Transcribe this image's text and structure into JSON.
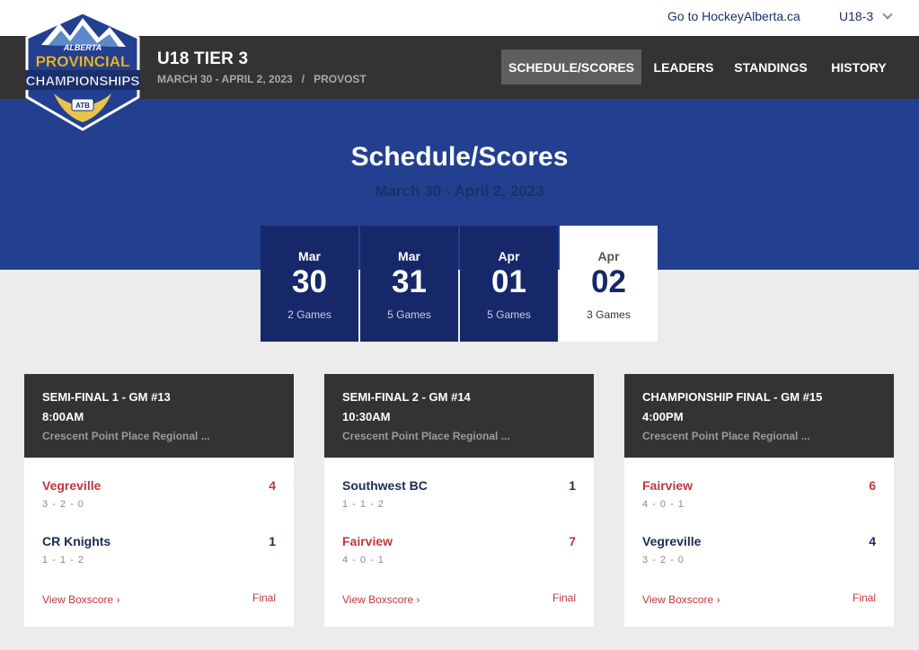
{
  "utility": {
    "link": "Go to HockeyAlberta.ca",
    "division": "U18-3"
  },
  "logo": {
    "line1": "ALBERTA",
    "line2": "PROVINCIAL",
    "line3": "CHAMPIONSHIPS",
    "sponsor": "ATB"
  },
  "event": {
    "title": "U18 TIER 3",
    "dates": "MARCH 30 - APRIL 2, 2023",
    "separator": "/",
    "location": "PROVOST"
  },
  "nav": [
    "SCHEDULE/SCORES",
    "LEADERS",
    "STANDINGS",
    "HISTORY"
  ],
  "page": {
    "title": "Schedule/Scores",
    "dates": "March 30 - April 2, 2023"
  },
  "days": [
    {
      "month": "Mar",
      "day": "30",
      "games": "2 Games"
    },
    {
      "month": "Mar",
      "day": "31",
      "games": "5 Games"
    },
    {
      "month": "Apr",
      "day": "01",
      "games": "5 Games"
    },
    {
      "month": "Apr",
      "day": "02",
      "games": "3 Games"
    }
  ],
  "games": [
    {
      "title": "SEMI-FINAL 1 - GM #13",
      "time": "8:00AM",
      "venue": "Crescent Point Place Regional ...",
      "teams": [
        {
          "name": "Vegreville",
          "record": "3 - 2 - 0",
          "score": "4"
        },
        {
          "name": "CR Knights",
          "record": "1 - 1 - 2",
          "score": "1"
        }
      ],
      "boxscore": "View Boxscore ›",
      "status": "Final"
    },
    {
      "title": "SEMI-FINAL 2 - GM #14",
      "time": "10:30AM",
      "venue": "Crescent Point Place Regional ...",
      "teams": [
        {
          "name": "Southwest BC",
          "record": "1 - 1 - 2",
          "score": "1"
        },
        {
          "name": "Fairview",
          "record": "4 - 0 - 1",
          "score": "7"
        }
      ],
      "boxscore": "View Boxscore ›",
      "status": "Final"
    },
    {
      "title": "CHAMPIONSHIP FINAL - GM #15",
      "time": "4:00PM",
      "venue": "Crescent Point Place Regional ...",
      "teams": [
        {
          "name": "Fairview",
          "record": "4 - 0 - 1",
          "score": "6"
        },
        {
          "name": "Vegreville",
          "record": "3 - 2 - 0",
          "score": "4"
        }
      ],
      "boxscore": "View Boxscore ›",
      "status": "Final"
    }
  ],
  "colors": {
    "header": "#333333",
    "band": "#22408f",
    "tab": "#17286a",
    "winner": "#c0373f",
    "team": "#1c2c57"
  }
}
